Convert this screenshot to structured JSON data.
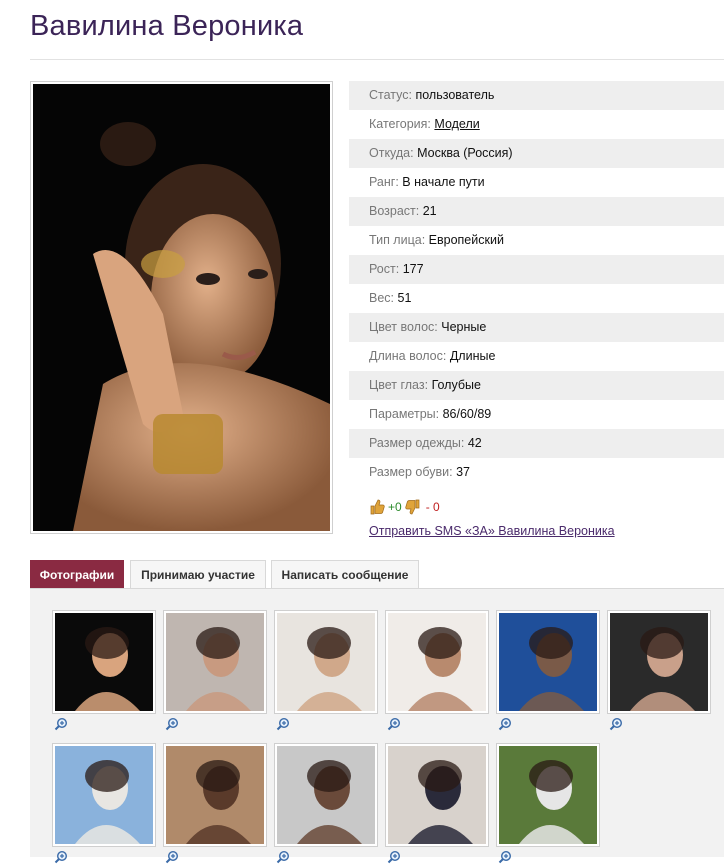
{
  "profile": {
    "name": "Вавилина Вероника",
    "photo_alt": "profile-photo"
  },
  "info": [
    {
      "key": "Статус:",
      "value": "пользователь"
    },
    {
      "key": "Категория:",
      "value": "Модели",
      "link": true
    },
    {
      "key": "Откуда:",
      "value": "Москва (Россия)"
    },
    {
      "key": "Ранг:",
      "value": "В начале пути"
    },
    {
      "key": "Возраст:",
      "value": "21"
    },
    {
      "key": "Тип лица:",
      "value": "Европейский"
    },
    {
      "key": "Рост:",
      "value": "177"
    },
    {
      "key": "Вес:",
      "value": "51"
    },
    {
      "key": "Цвет волос:",
      "value": "Черные"
    },
    {
      "key": "Длина волос:",
      "value": "Длиные"
    },
    {
      "key": "Цвет глаз:",
      "value": "Голубые"
    },
    {
      "key": "Параметры:",
      "value": "86/60/89"
    },
    {
      "key": "Размер одежды:",
      "value": "42"
    },
    {
      "key": "Размер обуви:",
      "value": "37"
    }
  ],
  "rating": {
    "plus": "+0",
    "minus": "- 0"
  },
  "sms_link": "Отправить SMS «ЗА» Вавилина Вероника",
  "tabs": [
    {
      "label": "Фотографии",
      "active": true
    },
    {
      "label": "Принимаю участие",
      "active": false
    },
    {
      "label": "Написать сообщение",
      "active": false
    }
  ],
  "colors": {
    "title": "#3b2457",
    "tab_active": "#8a2a42",
    "link": "#4a2a6b"
  },
  "gallery": {
    "thumbnails": [
      "photo-1",
      "photo-2",
      "photo-3",
      "photo-4",
      "photo-5",
      "photo-6",
      "photo-7",
      "photo-8",
      "photo-9",
      "photo-10",
      "photo-11"
    ]
  }
}
